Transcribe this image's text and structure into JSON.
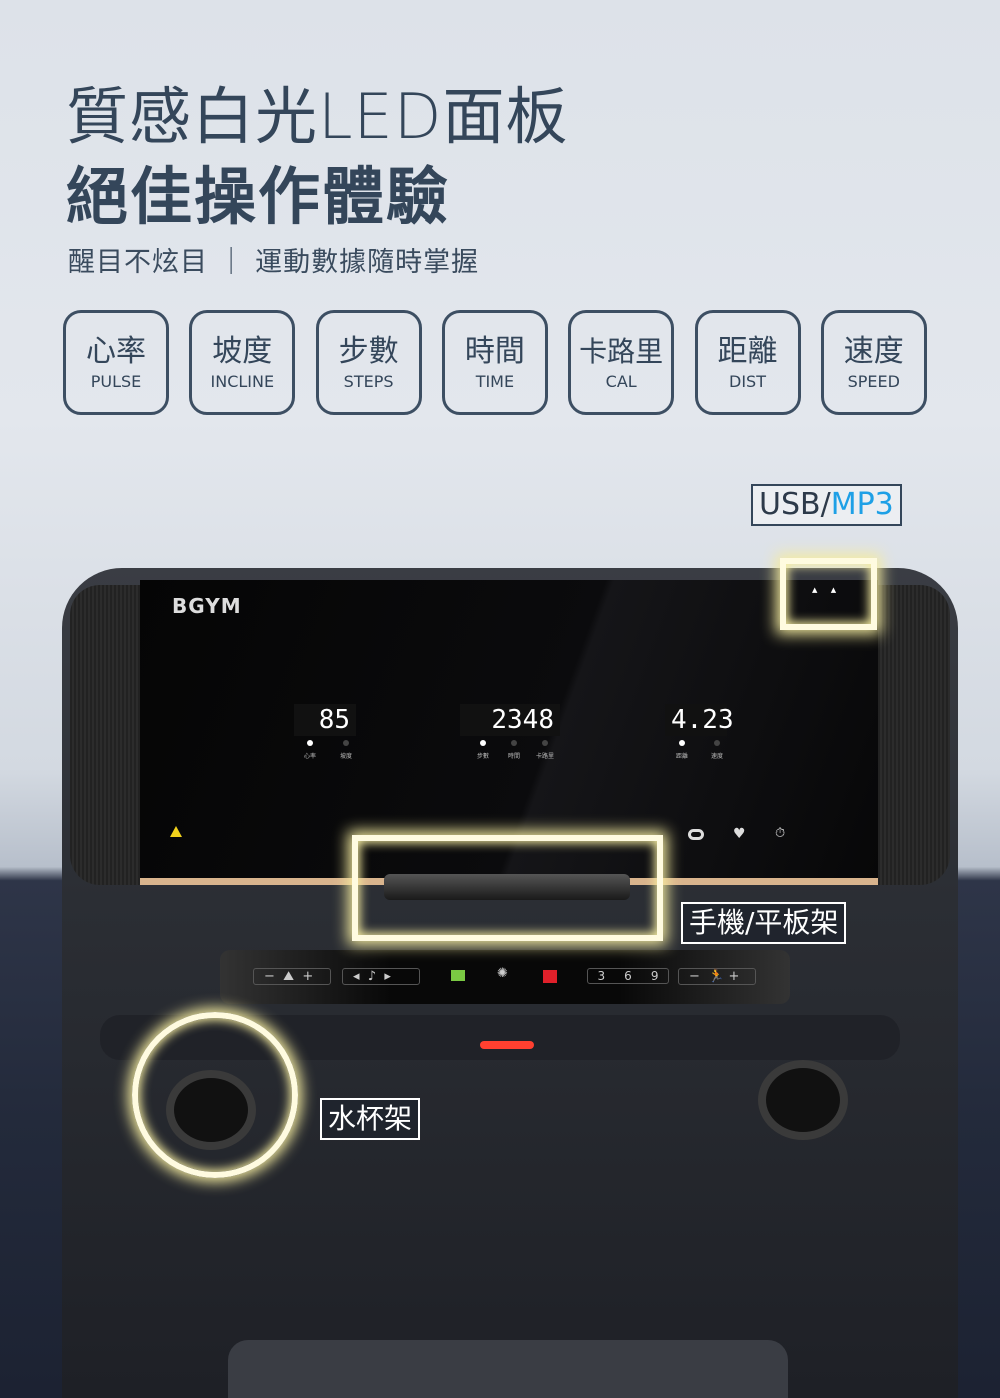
{
  "headline": {
    "line1": "質感白光LED面板",
    "line2": "絕佳操作體驗",
    "subtitle": "醒目不炫目 ｜ 運動數據隨時掌握"
  },
  "features": [
    {
      "zh": "心率",
      "en": "PULSE"
    },
    {
      "zh": "坡度",
      "en": "INCLINE"
    },
    {
      "zh": "步數",
      "en": "STEPS"
    },
    {
      "zh": "時間",
      "en": "TIME"
    },
    {
      "zh": "卡路里",
      "en": "CAL"
    },
    {
      "zh": "距離",
      "en": "DIST"
    },
    {
      "zh": "速度",
      "en": "SPEED"
    }
  ],
  "callouts": {
    "usb": "USB/",
    "mp3": "MP3",
    "holder": "手機/平板架",
    "cup": "水杯架"
  },
  "display": {
    "brand": "BGYM",
    "pulse": "85",
    "steps": "2348",
    "distance": "4.23",
    "labels": [
      "心率",
      "坡度",
      "步數",
      "時間",
      "卡路里",
      "距離",
      "速度"
    ]
  },
  "panel": {
    "presets": [
      "3",
      "6",
      "9"
    ]
  },
  "colors": {
    "text": "#34465a",
    "mp3": "#1ea0e6",
    "glow": "#fffbe0",
    "stop": "#e0202a",
    "program": "#7ac943"
  }
}
